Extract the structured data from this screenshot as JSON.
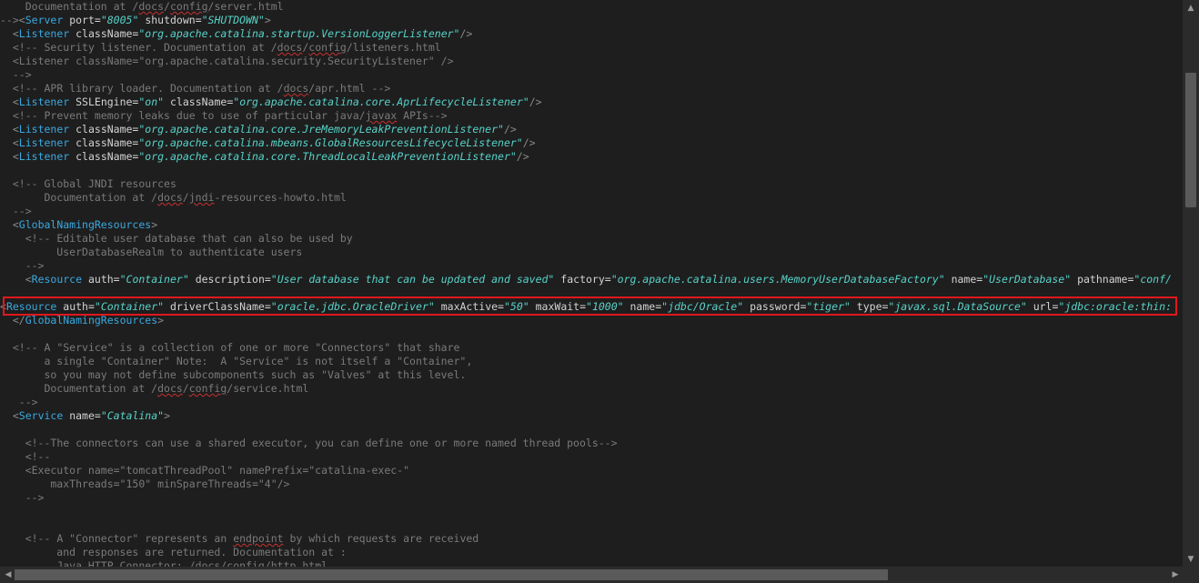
{
  "editor": {
    "lines": [
      "    Documentation at /docs/config/server.html",
      "--><Server port=\"8005\" shutdown=\"SHUTDOWN\">",
      "  <Listener className=\"org.apache.catalina.startup.VersionLoggerListener\"/>",
      "  <!-- Security listener. Documentation at /docs/config/listeners.html",
      "  <Listener className=\"org.apache.catalina.security.SecurityListener\" />",
      "  -->",
      "  <!-- APR library loader. Documentation at /docs/apr.html -->",
      "  <Listener SSLEngine=\"on\" className=\"org.apache.catalina.core.AprLifecycleListener\"/>",
      "  <!-- Prevent memory leaks due to use of particular java/javax APIs-->",
      "  <Listener className=\"org.apache.catalina.core.JreMemoryLeakPreventionListener\"/>",
      "  <Listener className=\"org.apache.catalina.mbeans.GlobalResourcesLifecycleListener\"/>",
      "  <Listener className=\"org.apache.catalina.core.ThreadLocalLeakPreventionListener\"/>",
      "",
      "  <!-- Global JNDI resources",
      "       Documentation at /docs/jndi-resources-howto.html",
      "  -->",
      "  <GlobalNamingResources>",
      "    <!-- Editable user database that can also be used by",
      "         UserDatabaseRealm to authenticate users",
      "    -->",
      "    <Resource auth=\"Container\" description=\"User database that can be updated and saved\" factory=\"org.apache.catalina.users.MemoryUserDatabaseFactory\" name=\"UserDatabase\" pathname=\"conf/",
      "",
      "<Resource auth=\"Container\" driverClassName=\"oracle.jdbc.OracleDriver\" maxActive=\"50\" maxWait=\"1000\" name=\"jdbc/Oracle\" password=\"tiger\" type=\"javax.sql.DataSource\" url=\"jdbc:oracle:thin:",
      "  </GlobalNamingResources>",
      "",
      "  <!-- A \"Service\" is a collection of one or more \"Connectors\" that share",
      "       a single \"Container\" Note:  A \"Service\" is not itself a \"Container\",",
      "       so you may not define subcomponents such as \"Valves\" at this level.",
      "       Documentation at /docs/config/service.html",
      "   -->",
      "  <Service name=\"Catalina\">",
      "",
      "    <!--The connectors can use a shared executor, you can define one or more named thread pools-->",
      "    <!--",
      "    <Executor name=\"tomcatThreadPool\" namePrefix=\"catalina-exec-\"",
      "        maxThreads=\"150\" minSpareThreads=\"4\"/>",
      "    -->",
      "",
      "",
      "    <!-- A \"Connector\" represents an endpoint by which requests are received",
      "         and responses are returned. Documentation at :",
      "         Java HTTP Connector: /docs/config/http.html"
    ]
  },
  "highlight_line_index": 22,
  "scrollbars": {
    "up_arrow": "▲",
    "down_arrow": "▼",
    "left_arrow": "◀",
    "right_arrow": "▶"
  },
  "colors": {
    "background": "#1e1e1e",
    "tag": "#3aa9e0",
    "attribute_value": "#57d3c9",
    "comment": "#7a7a7a",
    "highlight_border": "#e0171e"
  }
}
